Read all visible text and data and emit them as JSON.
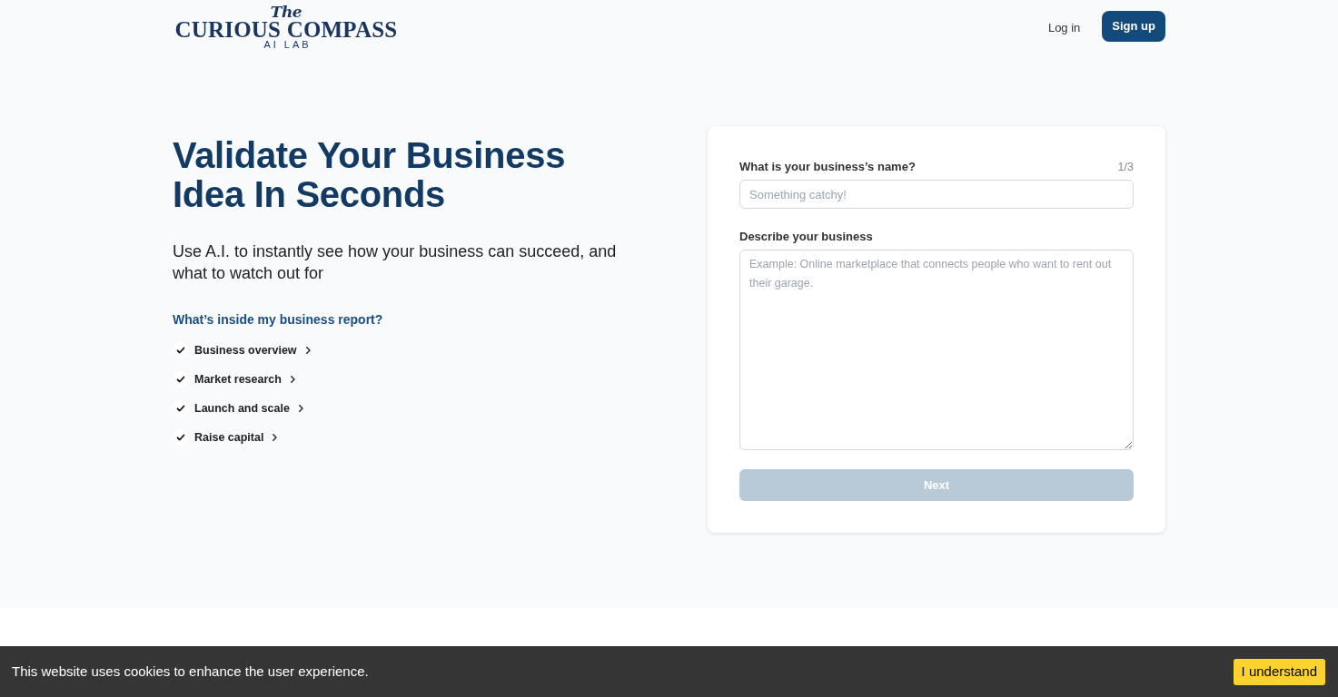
{
  "header": {
    "logo": {
      "script_word": "The",
      "wordmark": "CURIOUS COMPASS",
      "tagline": "AI LAB"
    },
    "nav": [
      {
        "label": "Log in",
        "kind": "link"
      },
      {
        "label": "Sign up",
        "kind": "button"
      }
    ]
  },
  "hero": {
    "title": "Validate Your Business Idea In Seconds",
    "subtitle": "Use A.I. to instantly see how your business can succeed, and what to watch out for",
    "report_heading": "What’s inside my business report?",
    "report_items": [
      "Business overview",
      "Market research",
      "Launch and scale",
      "Raise capital"
    ]
  },
  "form": {
    "step": "1/3",
    "fields": [
      {
        "kind": "input",
        "label": "What is your business’s name?",
        "placeholder": "Something catchy!"
      },
      {
        "kind": "textarea",
        "label": "Describe your business",
        "placeholder": "Example: Online marketplace that connects people who want to rent out their garage."
      }
    ],
    "submit": {
      "label": "Next",
      "disabled": true
    }
  },
  "cookie_banner": {
    "message": "This website uses cookies to enhance the user experience.",
    "button": "I understand"
  }
}
